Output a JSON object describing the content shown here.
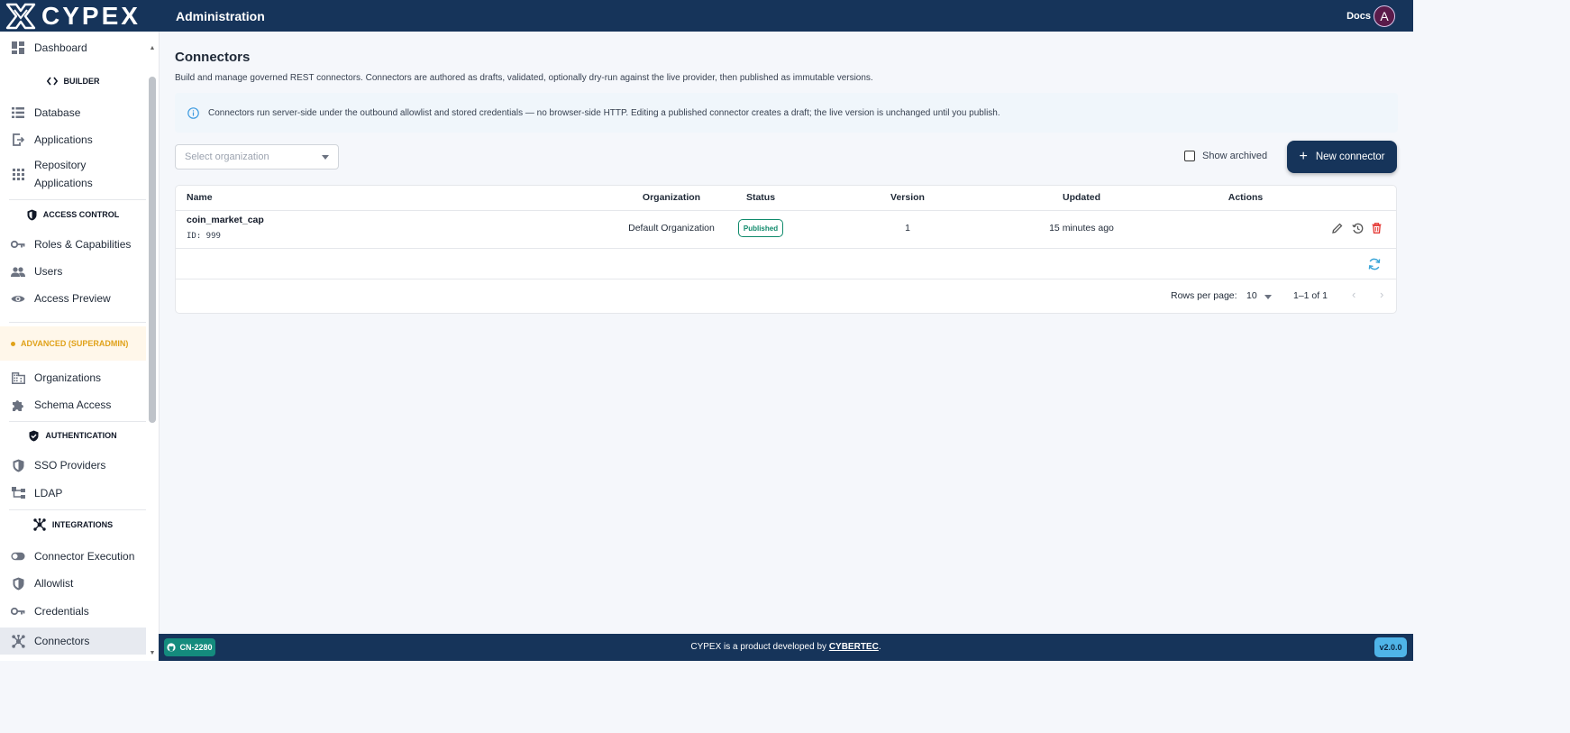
{
  "brand": {
    "name": "CYPEX"
  },
  "header": {
    "title": "Administration",
    "docs": "Docs",
    "avatar_initial": "A"
  },
  "sidebar": {
    "dashboard": "Dashboard",
    "builder_header": "BUILDER",
    "database": "Database",
    "applications": "Applications",
    "repository_line1": "Repository",
    "repository_line2": "Applications",
    "access_control_header": "ACCESS CONTROL",
    "roles": "Roles & Capabilities",
    "users": "Users",
    "access_preview": "Access Preview",
    "advanced_header": "ADVANCED (SUPERADMIN)",
    "organizations": "Organizations",
    "schema_access": "Schema Access",
    "authentication_header": "AUTHENTICATION",
    "sso": "SSO Providers",
    "ldap": "LDAP",
    "integrations_header": "INTEGRATIONS",
    "connector_execution": "Connector Execution",
    "allowlist": "Allowlist",
    "credentials": "Credentials",
    "connectors": "Connectors"
  },
  "main": {
    "title": "Connectors",
    "description": "Build and manage governed REST connectors. Connectors are authored as drafts, validated, optionally dry-run against the live provider, then published as immutable versions.",
    "info": "Connectors run server-side under the outbound allowlist and stored credentials — no browser-side HTTP. Editing a published connector creates a draft; the live version is unchanged until you publish.",
    "org_select_placeholder": "Select organization",
    "show_archived": "Show archived",
    "new_connector": "New connector"
  },
  "table": {
    "headers": {
      "name": "Name",
      "organization": "Organization",
      "status": "Status",
      "version": "Version",
      "updated": "Updated",
      "actions": "Actions"
    },
    "rows": [
      {
        "name": "coin_market_cap",
        "id": "ID: 999",
        "organization": "Default Organization",
        "status": "Published",
        "version": "1",
        "updated": "15 minutes ago"
      }
    ],
    "pagination": {
      "rows_per_page_label": "Rows per page:",
      "rows_per_page": "10",
      "range": "1–1 of 1"
    }
  },
  "footer": {
    "branch": "CN-2280",
    "text_prefix": "CYPEX is a product developed by ",
    "company": "CYBERTEC",
    "text_suffix": ".",
    "version": "v2.0.0"
  },
  "colors": {
    "navy": "#16345a",
    "teal": "#148b7d",
    "published": "#0f8a6b",
    "delete": "#e53935",
    "advanced": "#e0a21a",
    "version_badge": "#4fb4e8"
  }
}
